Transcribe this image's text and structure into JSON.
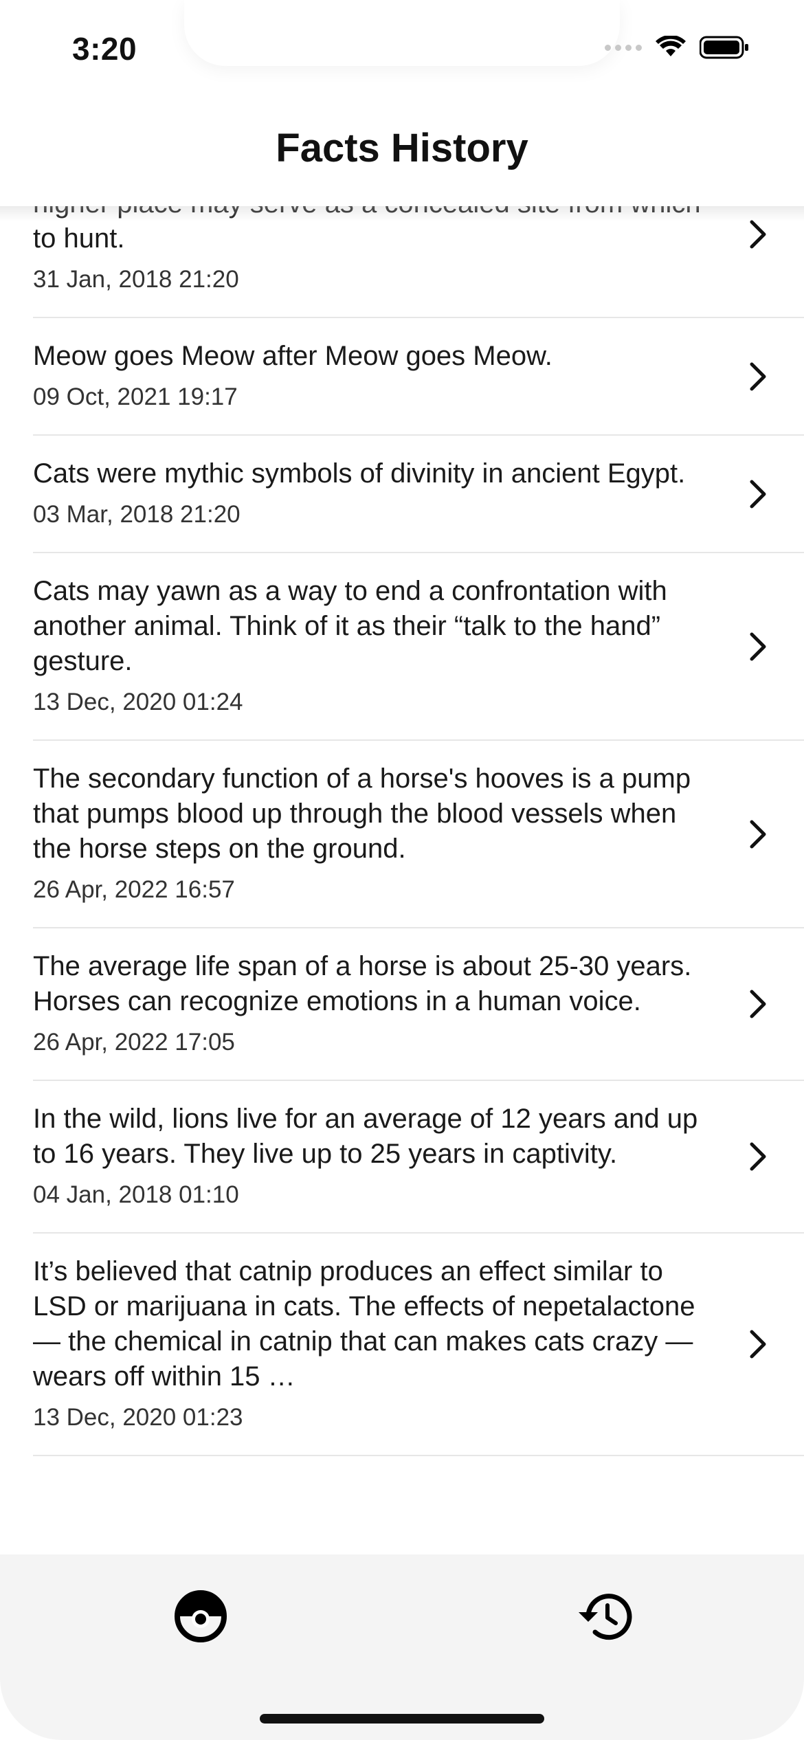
{
  "status": {
    "time": "3:20"
  },
  "header": {
    "title": "Facts History"
  },
  "facts": [
    {
      "text": "settling in high places, or perching. In the wild, a higher place may serve as a concealed site from which to hunt.",
      "date": "31 Jan, 2018 21:20"
    },
    {
      "text": "Meow goes Meow after Meow goes Meow.",
      "date": "09 Oct, 2021 19:17"
    },
    {
      "text": "Cats were mythic symbols of divinity in ancient Egypt.",
      "date": "03 Mar, 2018 21:20"
    },
    {
      "text": "Cats may yawn as a way to end a confrontation with another animal. Think of it as their “talk to the hand” gesture.",
      "date": "13 Dec, 2020 01:24"
    },
    {
      "text": "The secondary function of a horse's hooves is a pump that pumps blood up through the blood vessels when the horse steps on the ground.",
      "date": "26 Apr, 2022 16:57"
    },
    {
      "text": "The average life span of a horse is about 25-30 years. Horses can recognize emotions in a human voice.",
      "date": "26 Apr, 2022 17:05"
    },
    {
      "text": "In the wild, lions live for an average of 12 years and up to 16 years. They live up to 25 years in captivity.",
      "date": "04 Jan, 2018 01:10"
    },
    {
      "text": "It’s believed that catnip produces an effect similar to LSD or marijuana in cats. The effects of nepetalactone — the chemical in catnip that can makes cats crazy — wears off within 15 …",
      "date": "13 Dec, 2020 01:23"
    }
  ],
  "tabs": [
    {
      "icon": "pokeball-icon"
    },
    {
      "icon": "history-icon"
    }
  ]
}
